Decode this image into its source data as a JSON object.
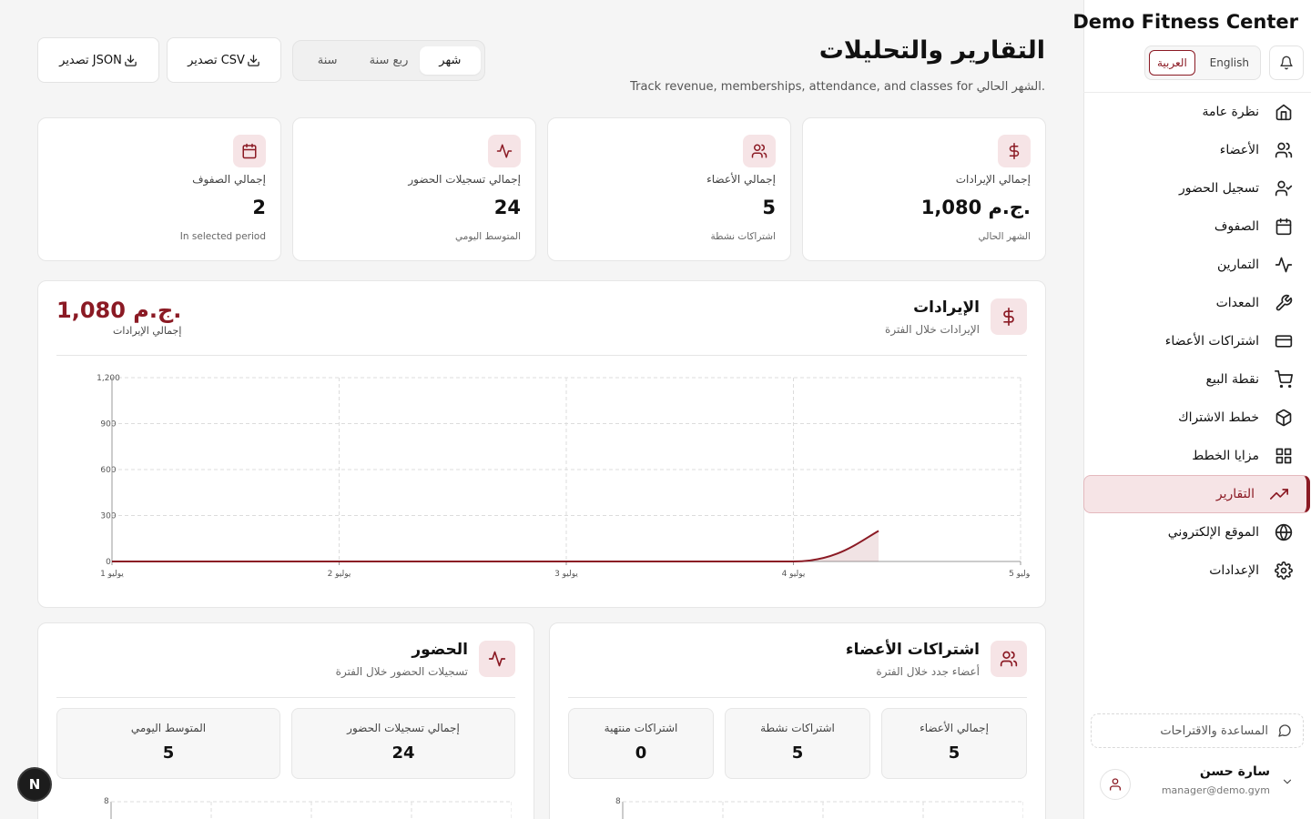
{
  "app": {
    "brand": "Demo Fitness Center",
    "lang": {
      "english": "English",
      "arabic": "العربية",
      "active": "arabic"
    },
    "accent": "#8b1a24",
    "fab_label": "N"
  },
  "sidebar": {
    "items": [
      {
        "label": "نظرة عامة",
        "icon": "home-icon"
      },
      {
        "label": "الأعضاء",
        "icon": "users-icon"
      },
      {
        "label": "تسجيل الحضور",
        "icon": "user-check-icon"
      },
      {
        "label": "الصفوف",
        "icon": "calendar-icon"
      },
      {
        "label": "التمارين",
        "icon": "activity-icon"
      },
      {
        "label": "المعدات",
        "icon": "wrench-icon"
      },
      {
        "label": "اشتراكات الأعضاء",
        "icon": "credit-card-icon"
      },
      {
        "label": "نقطة البيع",
        "icon": "cart-icon"
      },
      {
        "label": "خطط الاشتراك",
        "icon": "package-icon"
      },
      {
        "label": "مزايا الخطط",
        "icon": "grid-icon"
      },
      {
        "label": "التقارير",
        "icon": "trending-up-icon",
        "active": true
      },
      {
        "label": "الموقع الإلكتروني",
        "icon": "globe-icon"
      },
      {
        "label": "الإعدادات",
        "icon": "gear-icon"
      }
    ],
    "help": "المساعدة والاقتراحات",
    "user": {
      "name": "سارة حسن",
      "email": "manager@demo.gym"
    }
  },
  "header": {
    "title": "التقارير والتحليلات",
    "subtitle": "Track revenue, memberships, attendance, and classes for الشهر الحالي.",
    "periods": [
      "شهر",
      "ربع سنة",
      "سنة"
    ],
    "active_period": "شهر",
    "export_csv": "تصدير CSV",
    "export_json": "تصدير JSON"
  },
  "stats": [
    {
      "label": "إجمالي الإيرادات",
      "value": "1,080 ج.م.",
      "note": "الشهر الحالي",
      "icon": "dollar-icon"
    },
    {
      "label": "إجمالي الأعضاء",
      "value": "5",
      "note": "اشتراكات نشطة",
      "icon": "users-icon"
    },
    {
      "label": "إجمالي تسجيلات الحضور",
      "value": "24",
      "note": "المتوسط اليومي",
      "icon": "activity-icon"
    },
    {
      "label": "إجمالي الصفوف",
      "value": "2",
      "note": "In selected period",
      "icon": "calendar-icon"
    }
  ],
  "revenue": {
    "title": "الإيرادات",
    "subtitle": "الإيرادات خلال الفترة",
    "total_value": "1,080 ج.م.",
    "total_label": "إجمالي الإيرادات"
  },
  "members_panel": {
    "title": "اشتراكات الأعضاء",
    "subtitle": "أعضاء جدد خلال الفترة",
    "cards": [
      {
        "label": "إجمالي الأعضاء",
        "value": "5"
      },
      {
        "label": "اشتراكات نشطة",
        "value": "5"
      },
      {
        "label": "اشتراكات منتهية",
        "value": "0"
      }
    ],
    "chart_top_tick": "8"
  },
  "attendance_panel": {
    "title": "الحضور",
    "subtitle": "تسجيلات الحضور خلال الفترة",
    "cards": [
      {
        "label": "إجمالي تسجيلات الحضور",
        "value": "24"
      },
      {
        "label": "المتوسط اليومي",
        "value": "5"
      }
    ],
    "chart_top_tick": "8"
  },
  "chart_data": {
    "type": "area",
    "title": "",
    "xlabel": "",
    "ylabel": "",
    "categories": [
      "1 يوليو",
      "2 يوليو",
      "3 يوليو",
      "4 يوليو",
      "5 يوليو"
    ],
    "yticks": [
      "0",
      "300",
      "600",
      "900",
      "1,200"
    ],
    "ylim": [
      0,
      1200
    ],
    "grid": true,
    "color": "#8b1a24",
    "points": [
      {
        "x": 0,
        "y": 0
      },
      {
        "x": 1,
        "y": 0
      },
      {
        "x": 2,
        "y": 0
      },
      {
        "x": 3,
        "y": 0
      },
      {
        "x": 3.375,
        "y": 200
      }
    ]
  }
}
